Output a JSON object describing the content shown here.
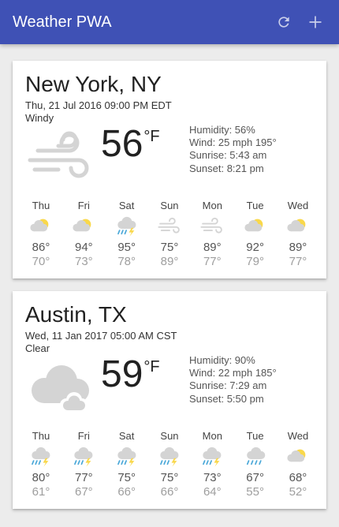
{
  "app": {
    "title": "Weather PWA",
    "refresh_icon": "refresh-icon",
    "add_icon": "add-icon"
  },
  "cards": [
    {
      "city": "New York, NY",
      "date": "Thu, 21 Jul 2016 09:00 PM EDT",
      "description": "Windy",
      "icon": "wind",
      "temperature": "56",
      "unit": "°F",
      "humidity": "Humidity: 56%",
      "wind": "Wind: 25 mph 195°",
      "sunrise": "Sunrise: 5:43 am",
      "sunset": "Sunset: 8:21 pm",
      "forecast": [
        {
          "day": "Thu",
          "icon": "partly-cloudy",
          "high": "86°",
          "low": "70°"
        },
        {
          "day": "Fri",
          "icon": "partly-cloudy",
          "high": "94°",
          "low": "73°"
        },
        {
          "day": "Sat",
          "icon": "thunderstorm",
          "high": "95°",
          "low": "78°"
        },
        {
          "day": "Sun",
          "icon": "wind",
          "high": "75°",
          "low": "89°"
        },
        {
          "day": "Mon",
          "icon": "wind",
          "high": "89°",
          "low": "77°"
        },
        {
          "day": "Tue",
          "icon": "partly-cloudy",
          "high": "92°",
          "low": "79°"
        },
        {
          "day": "Wed",
          "icon": "partly-cloudy",
          "high": "89°",
          "low": "77°"
        }
      ]
    },
    {
      "city": "Austin, TX",
      "date": "Wed, 11 Jan 2017 05:00 AM CST",
      "description": "Clear",
      "icon": "cloudy",
      "temperature": "59",
      "unit": "°F",
      "humidity": "Humidity: 90%",
      "wind": "Wind: 22 mph 185°",
      "sunrise": "Sunrise: 7:29 am",
      "sunset": "Sunset: 5:50 pm",
      "forecast": [
        {
          "day": "Thu",
          "icon": "thunderstorm",
          "high": "80°",
          "low": "61°"
        },
        {
          "day": "Fri",
          "icon": "thunderstorm",
          "high": "77°",
          "low": "67°"
        },
        {
          "day": "Sat",
          "icon": "thunderstorm",
          "high": "75°",
          "low": "66°"
        },
        {
          "day": "Sun",
          "icon": "thunderstorm",
          "high": "75°",
          "low": "66°"
        },
        {
          "day": "Mon",
          "icon": "thunderstorm",
          "high": "73°",
          "low": "64°"
        },
        {
          "day": "Tue",
          "icon": "rain",
          "high": "67°",
          "low": "55°"
        },
        {
          "day": "Wed",
          "icon": "partly-cloudy",
          "high": "68°",
          "low": "52°"
        }
      ]
    }
  ],
  "colors": {
    "appbar": "#3f51b5",
    "sun": "#f9d84a",
    "cloud": "#d4d4d4",
    "rain": "#4aa8d8",
    "bolt": "#f9d84a"
  }
}
